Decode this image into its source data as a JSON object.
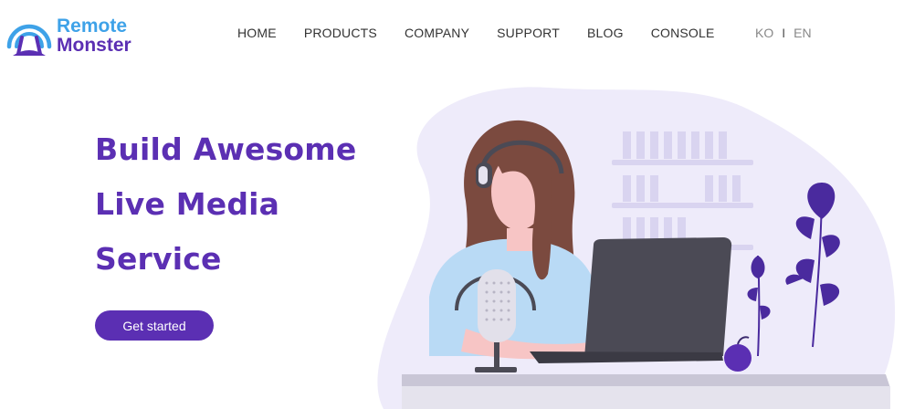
{
  "brand": {
    "line1": "Remote",
    "line2": "Monster",
    "colors": {
      "blue": "#3ea2e8",
      "purple": "#5b2fb3"
    },
    "icon": "monster-antenna-icon"
  },
  "nav": {
    "items": [
      "HOME",
      "PRODUCTS",
      "COMPANY",
      "SUPPORT",
      "BLOG",
      "CONSOLE"
    ]
  },
  "language": {
    "ko": "KO",
    "separator": "I",
    "en": "EN"
  },
  "hero": {
    "title_lines": [
      "Build Awesome",
      "Live Media",
      "Service"
    ],
    "cta_label": "Get started"
  },
  "illustration": {
    "subject": "woman-with-headset-at-laptop-illustration"
  }
}
